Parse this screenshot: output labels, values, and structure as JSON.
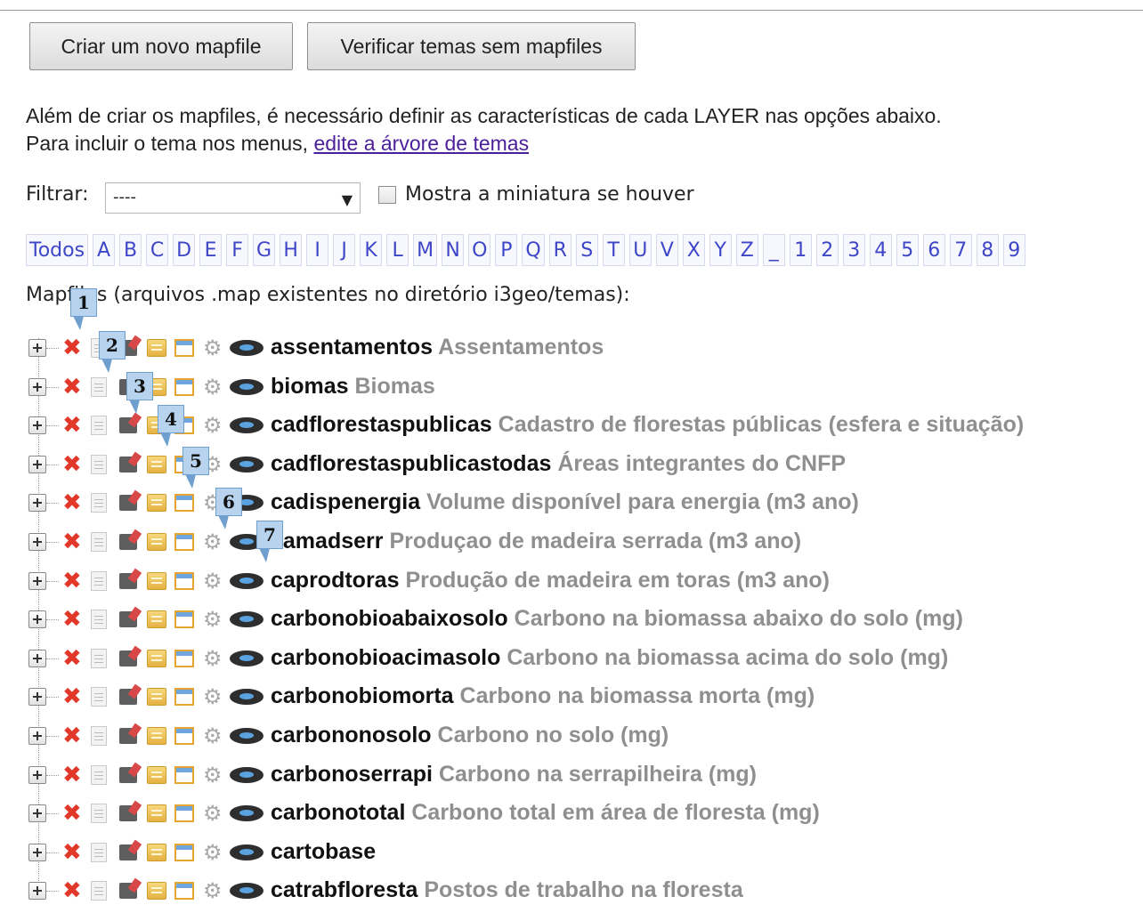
{
  "buttons": {
    "create": "Criar um novo mapfile",
    "verify": "Verificar temas sem mapfiles"
  },
  "intro": {
    "line1": "Além de criar os mapfiles, é necessário definir as características de cada LAYER nas opções abaixo.",
    "line2_prefix": "Para incluir o tema nos menus, ",
    "line2_link": "edite a árvore de temas"
  },
  "filter": {
    "label": "Filtrar:",
    "value": "----",
    "checkbox_label": "Mostra a miniatura se houver"
  },
  "letters": [
    "Todos",
    "A",
    "B",
    "C",
    "D",
    "E",
    "F",
    "G",
    "H",
    "I",
    "J",
    "K",
    "L",
    "M",
    "N",
    "O",
    "P",
    "Q",
    "R",
    "S",
    "T",
    "U",
    "V",
    "X",
    "Y",
    "Z",
    "_",
    "1",
    "2",
    "3",
    "4",
    "5",
    "6",
    "7",
    "8",
    "9"
  ],
  "maps_label": "Mapfiles (arquivos .map existentes no diretório i3geo/temas):",
  "rows": [
    {
      "name": "assentamentos",
      "title": "Assentamentos"
    },
    {
      "name": "biomas",
      "title": "Biomas"
    },
    {
      "name": "cadflorestaspublicas",
      "title": "Cadastro de florestas públicas (esfera e situação)"
    },
    {
      "name": "cadflorestaspublicastodas",
      "title": "Áreas integrantes do CNFP"
    },
    {
      "name": "cadispenergia",
      "title": "Volume disponível para energia (m3 ano)"
    },
    {
      "name": "camadserr",
      "title": "Produçao de madeira serrada (m3 ano)"
    },
    {
      "name": "caprodtoras",
      "title": "Produção de madeira em toras (m3 ano)"
    },
    {
      "name": "carbonobioabaixosolo",
      "title": "Carbono na biomassa abaixo do solo (mg)"
    },
    {
      "name": "carbonobioacimasolo",
      "title": "Carbono na biomassa acima do solo (mg)"
    },
    {
      "name": "carbonobiomorta",
      "title": "Carbono na biomassa morta (mg)"
    },
    {
      "name": "carbononosolo",
      "title": "Carbono no solo (mg)"
    },
    {
      "name": "carbonoserrapi",
      "title": "Carbono na serrapilheira (mg)"
    },
    {
      "name": "carbonototal",
      "title": "Carbono total em área de floresta (mg)"
    },
    {
      "name": "cartobase",
      "title": ""
    },
    {
      "name": "catrabfloresta",
      "title": "Postos de trabalho na floresta"
    }
  ],
  "callouts": [
    "1",
    "2",
    "3",
    "4",
    "5",
    "6",
    "7"
  ],
  "icons": [
    "expand-icon",
    "delete-icon",
    "document-icon",
    "edit-icon",
    "layer-icon",
    "table-icon",
    "gear-icon",
    "cloud-icon"
  ]
}
